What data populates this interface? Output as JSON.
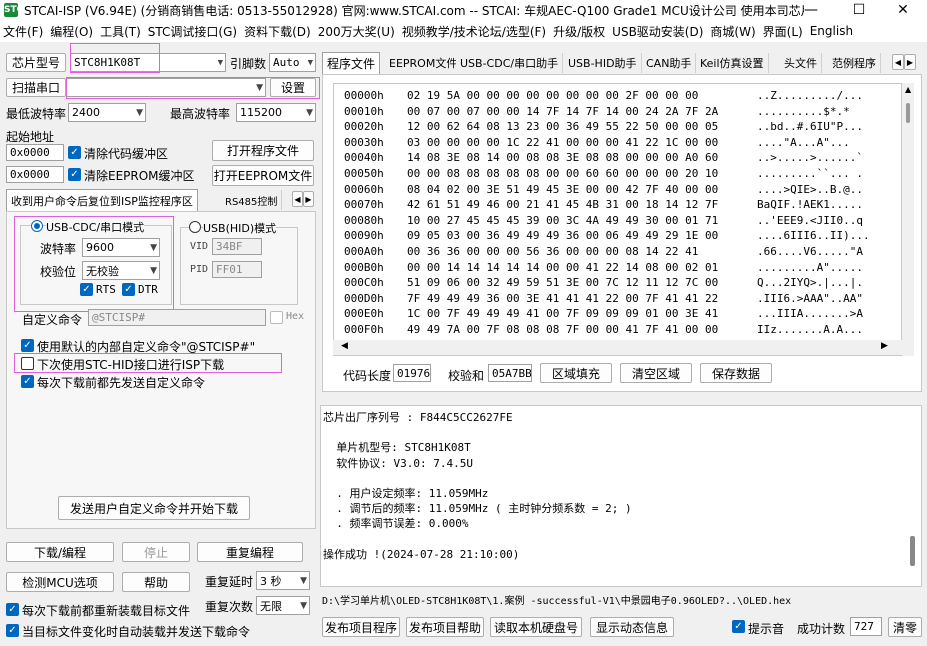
{
  "window": {
    "icon_text": "STC",
    "title": "STCAI-ISP (V6.94E) (分销商销售电话: 0513-55012928) 官网:www.STCAI.com  -- STCAI: 车规AEC-Q100 Grade1 MCU设计公司 使用本司芯片或采...",
    "minimize": "—",
    "maximize": "☐",
    "close": "✕"
  },
  "menu": [
    "文件(F)",
    "编程(O)",
    "工具(T)",
    "STC调试接口(G)",
    "资料下载(D)",
    "200万大奖(U)",
    "视频教学/技术论坛/选型(F)",
    "升级/版权",
    "USB驱动安装(D)",
    "商城(W)",
    "界面(L)",
    "English"
  ],
  "left": {
    "chip_type_btn": "芯片型号",
    "chip_type_value": "STC8H1K08T",
    "pins_label": "引脚数",
    "pins_value": "Auto",
    "scan_port_btn": "扫描串口",
    "port_value": "",
    "settings_btn": "设置",
    "min_baud_label": "最低波特率",
    "min_baud_value": "2400",
    "max_baud_label": "最高波特率",
    "max_baud_value": "115200",
    "start_addr_label": "起始地址",
    "addr1": "0x0000",
    "clear_code_buf": "清除代码缓冲区",
    "open_program_btn": "打开程序文件",
    "addr2": "0x0000",
    "clear_eeprom_buf": "清除EEPROM缓冲区",
    "open_eeprom_btn": "打开EEPROM文件",
    "tabs": [
      "收到用户命令后复位到ISP监控程序区",
      "RS485控制"
    ],
    "usb_cdc_mode": "USB-CDC/串口模式",
    "usb_hid_mode": "USB(HID)模式",
    "baud_label": "波特率",
    "baud_value": "9600",
    "parity_label": "校验位",
    "parity_value": "无校验",
    "rts": "RTS",
    "dtr": "DTR",
    "vid_label": "VID",
    "vid_value": "34BF",
    "pid_label": "PID",
    "pid_value": "FF01",
    "custom_cmd_label": "自定义命令",
    "custom_cmd_placeholder": "@STCISP#",
    "hex_label": "Hex",
    "use_default_cmd": "使用默认的内部自定义命令\"@STCISP#\"",
    "next_use_hid": "下次使用STC-HID接口进行ISP下载",
    "send_before_download": "每次下载前都先发送自定义命令",
    "send_and_download_btn": "发送用户自定义命令并开始下载",
    "download_btn": "下载/编程",
    "stop_btn": "停止",
    "reprogram_btn": "重复编程",
    "detect_mcu_btn": "检测MCU选项",
    "help_btn": "帮助",
    "repeat_delay_label": "重复延时",
    "repeat_delay_value": "3 秒",
    "repeat_count_label": "重复次数",
    "repeat_count_value": "无限",
    "reload_each_time": "每次下载前都重新装载目标文件",
    "auto_reload": "当目标文件变化时自动装载并发送下载命令"
  },
  "right": {
    "tabs": [
      "程序文件",
      "EEPROM文件",
      "USB-CDC/串口助手",
      "USB-HID助手",
      "CAN助手",
      "Keil仿真设置",
      "头文件",
      "范例程序"
    ],
    "hex_rows": [
      {
        "addr": "00000h",
        "bytes": "02 19 5A 00 00 00 00 00 00 00 00 2F 00 00 00",
        "ascii": "..Z........./..."
      },
      {
        "addr": "00010h",
        "bytes": "00 07 00 07 00 00 14 7F 14 7F 14 00 24 2A 7F 2A",
        "ascii": "..........$*.*"
      },
      {
        "addr": "00020h",
        "bytes": "12 00 62 64 08 13 23 00 36 49 55 22 50 00 00 05",
        "ascii": "..bd..#.6IU\"P..."
      },
      {
        "addr": "00030h",
        "bytes": "03 00 00 00 00 1C 22 41 00 00 00 41 22 1C 00 00",
        "ascii": "....\"A...A\"..."
      },
      {
        "addr": "00040h",
        "bytes": "14 08 3E 08 14 00 08 08 3E 08 08 00 00 00 A0 60",
        "ascii": "..>.....>......`"
      },
      {
        "addr": "00050h",
        "bytes": "00 00 08 08 08 08 08 00 00 60 60 00 00 00 20 10",
        "ascii": ".........``... ."
      },
      {
        "addr": "00060h",
        "bytes": "08 04 02 00 3E 51 49 45 3E 00 00 42 7F 40 00 00",
        "ascii": "....>QIE>..B.@.."
      },
      {
        "addr": "00070h",
        "bytes": "42 61 51 49 46 00 21 41 45 4B 31 00 18 14 12 7F",
        "ascii": "BaQIF.!AEK1....."
      },
      {
        "addr": "00080h",
        "bytes": "10 00 27 45 45 45 39 00 3C 4A 49 49 30 00 01 71",
        "ascii": "..'EEE9.<JII0..q"
      },
      {
        "addr": "00090h",
        "bytes": "09 05 03 00 36 49 49 49 36 00 06 49 49 29 1E 00",
        "ascii": "....6III6..II)..."
      },
      {
        "addr": "000A0h",
        "bytes": "00 36 36 00 00 00 56 36 00 00 00 08 14 22 41",
        "ascii": ".66....V6.....\"A"
      },
      {
        "addr": "000B0h",
        "bytes": "00 00 14 14 14 14 14 00 00 41 22 14 08 00 02 01",
        "ascii": ".........A\"....."
      },
      {
        "addr": "000C0h",
        "bytes": "51 09 06 00 32 49 59 51 3E 00 7C 12 11 12 7C 00",
        "ascii": "Q...2IYQ>.|...|."
      },
      {
        "addr": "000D0h",
        "bytes": "7F 49 49 49 36 00 3E 41 41 41 22 00 7F 41 41 22",
        "ascii": ".III6.>AAA\"..AA\""
      },
      {
        "addr": "000E0h",
        "bytes": "1C 00 7F 49 49 49 41 00 7F 09 09 09 01 00 3E 41",
        "ascii": "...IIIA.......>A"
      },
      {
        "addr": "000F0h",
        "bytes": "49 49 7A 00 7F 08 08 08 7F 00 00 41 7F 41 00 00",
        "ascii": "IIz.......A.A..."
      }
    ],
    "code_length_label": "代码长度",
    "code_length_value": "01976",
    "checksum_label": "校验和",
    "checksum_value": "05A7BB",
    "fill_region_btn": "区域填充",
    "clear_region_btn": "清空区域",
    "save_data_btn": "保存数据",
    "log_lines": [
      "芯片出厂序列号 : F844C5CC2627FE",
      "",
      "  单片机型号: STC8H1K08T",
      "  软件协议: V3.0: 7.4.5U",
      "",
      "  . 用户设定频率: 11.059MHz",
      "  . 调节后的频率: 11.059MHz ( 主时钟分频系数 = 2; )",
      "  . 频率调节误差: 0.000%",
      "",
      "操作成功 !(2024-07-28 21:10:00)"
    ],
    "file_path": "D:\\学习单片机\\OLED-STC8H1K08T\\1.案例 -successful-V1\\中景园电子0.96OLED?..\\OLED.hex",
    "publish_program_btn": "发布项目程序",
    "publish_help_btn": "发布项目帮助",
    "read_serial_btn": "读取本机硬盘号",
    "show_animation_btn": "显示动态信息",
    "beep_label": "提示音",
    "success_count_label": "成功计数",
    "success_count_value": "727",
    "clear_btn": "清零"
  }
}
